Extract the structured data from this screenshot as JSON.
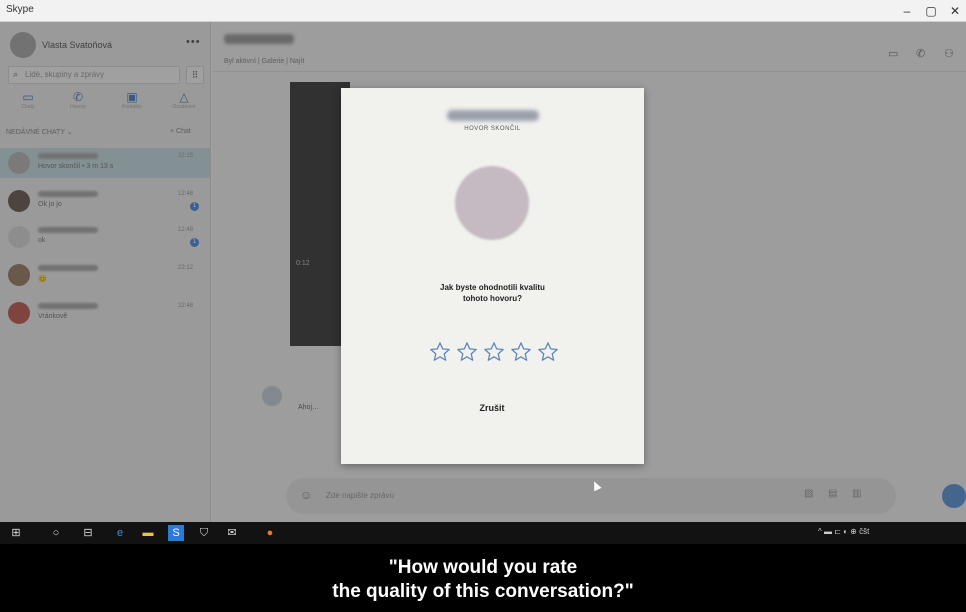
{
  "window": {
    "title": "Skype"
  },
  "sidebar": {
    "profile_name": "Vlasta Svatoňová",
    "more_label": "•••",
    "search_placeholder": "Lidé, skupiny a zprávy",
    "nav": [
      {
        "label": "Chaty",
        "icon": "chat-icon"
      },
      {
        "label": "Hovory",
        "icon": "phone-icon"
      },
      {
        "label": "Kontakty",
        "icon": "contacts-icon"
      },
      {
        "label": "Oznámení",
        "icon": "bell-icon"
      }
    ],
    "section_title": "NEDÁVNÉ CHATY ⌄",
    "new_chat": "+ Chat",
    "chats": [
      {
        "preview": "Hovor skončil • 3 m 13 s",
        "time": "22:15",
        "badge": ""
      },
      {
        "preview": "Ok jo jo",
        "time": "12:48",
        "badge": "1"
      },
      {
        "preview": "ok",
        "time": "12:48",
        "badge": "1"
      },
      {
        "preview": "😊",
        "time": "22:12",
        "badge": ""
      },
      {
        "preview": "Vránkově",
        "time": "22:48",
        "badge": ""
      }
    ]
  },
  "main": {
    "header_sub": "Byl aktivní | Galerie | Najít",
    "media_label": "0:12",
    "message": "Ahoj…",
    "compose_placeholder": "Zde napište zprávu"
  },
  "dialog": {
    "status": "HOVOR SKONČIL",
    "question_line1": "Jak byste ohodnotili kvalitu",
    "question_line2": "tohoto hovoru?",
    "stars_count": 5,
    "cancel_label": "Zrušit"
  },
  "taskbar": {
    "tray_text": "^ ▬ ⊏ ◐ ⊕ čšt"
  },
  "subtitle": {
    "line1": "\"How would you rate",
    "line2": "the quality of this conversation?\""
  },
  "colors": {
    "star_outline": "#5f86b8",
    "accent": "#3a7bd5"
  }
}
